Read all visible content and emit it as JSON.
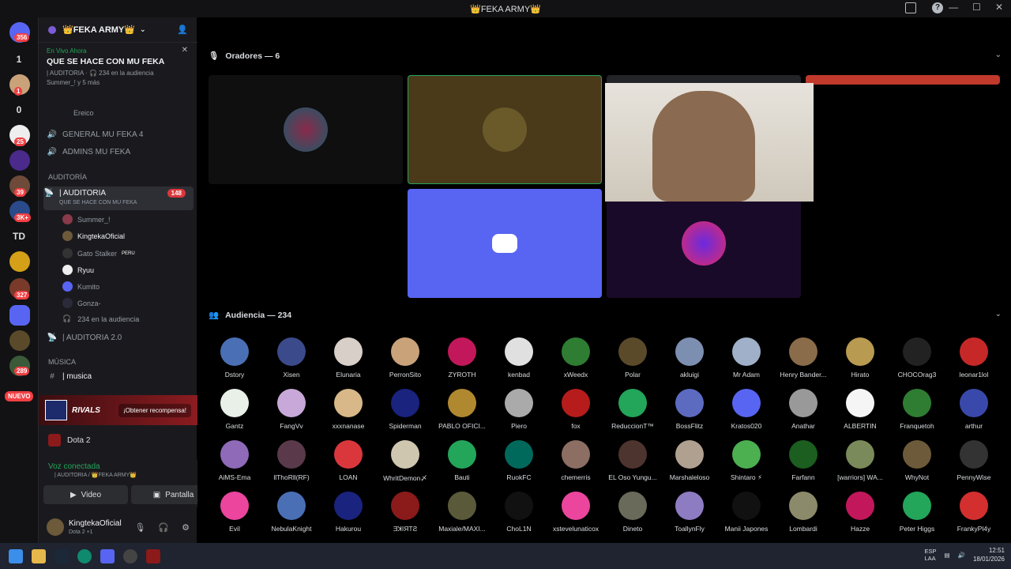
{
  "window": {
    "title": "👑FEKA ARMY👑"
  },
  "servers": {
    "badges": [
      "356",
      "1",
      "25",
      "39",
      "3K+",
      "327",
      "289"
    ],
    "letters": [
      "1",
      "0",
      "TD"
    ],
    "nuevo": "NUEVO"
  },
  "server": {
    "name": "👑FEKA ARMY👑"
  },
  "live": {
    "label": "En Vivo Ahora",
    "title": "QUE SE HACE CON MU FEKA",
    "meta": "| AUDITORIA · 🎧 234 en la audiencia",
    "speakers": "Summer_! y 5 más"
  },
  "channels": {
    "user_top": "Ereico",
    "vc1": "GENERAL MU FEKA 4",
    "vc2": "ADMINS MU FEKA",
    "cat1": "AUDITORÍA",
    "stage": "| AUDITORIA",
    "stage_badge": "148",
    "stage_topic": "QUE SE HACE CON MU FEKA",
    "users": [
      "Summer_!",
      "KingtekaOficial",
      "Gato Stalker",
      "Ryuu",
      "Kumito",
      "Gonza-"
    ],
    "gato_tag": "PERU",
    "audience": "234 en la audiencia",
    "stage2": "| AUDITORIA 2.0",
    "cat2": "MÚSICA",
    "text1": "| musica"
  },
  "banner": {
    "brand": "RIVALS",
    "claim": "¡Obtener recompensa!"
  },
  "game": {
    "name": "Dota 2"
  },
  "voice": {
    "status": "Voz conectada",
    "location": "| AUDITORIA / 👑FEKA ARMY👑",
    "video": "Video",
    "screen": "Pantalla"
  },
  "me": {
    "name": "KingtekaOficial",
    "status": "Dota 2 +1"
  },
  "stage_view": {
    "speakers_header": "Oradores — 6",
    "audience_header": "Audiencia — 234"
  },
  "audience": [
    "Dstory",
    "Xisen",
    "Elunaria",
    "PerronSito",
    "ZYROTH",
    "kenbad",
    "xWeedx",
    "Polar",
    "akluigi",
    "Mr Adam",
    "Henry Bander...",
    "Hirato",
    "CHOCOrag3",
    "leonar1lol",
    "Gantz",
    "FangVv",
    "xxxnanase",
    "Spiderman",
    "PABLO OFICI...",
    "Piero",
    "fox",
    "ReduccionT™",
    "BossFlitz",
    "Kratos020",
    "Anathar",
    "ALBERTIN",
    "Franquetoh",
    "arthur",
    "AiMS-Ema",
    "llThoRll(RF)",
    "LOAN",
    "WhritDemon〆",
    "Bauti",
    "RuokFC",
    "chemerris",
    "EL Oso Yungu...",
    "Marshaleloso",
    "Shintaro ⚡",
    "Farfann",
    "[warriors] WA...",
    "WhyNot",
    "PennyWise",
    "Evil",
    "NebulaKnight",
    "Hakurou",
    "ƎꓘIЯTƧ",
    "Maxiale/MAXI...",
    "ChoL1N",
    "xstevelunaticox",
    "Dineto",
    "ToallynFly",
    "Manii Japones",
    "Lombardi",
    "Hazze",
    "Peter Higgs",
    "FrankyPl4y"
  ],
  "audience_colors": [
    "#4a6fb5",
    "#3b4a8a",
    "#d8d0c8",
    "#c9a27a",
    "#c2185b",
    "#e0e0e0",
    "#2e7d32",
    "#5a4a2a",
    "#7c8fb0",
    "#9fb0c8",
    "#8a6b4a",
    "#b89a50",
    "#222",
    "#c62828",
    "#e8f0e8",
    "#c8a8d8",
    "#d8b888",
    "#1a237e",
    "#b08830",
    "#aaa",
    "#b71c1c",
    "#23a55a",
    "#5c6bc0",
    "#5865f2",
    "#999",
    "#f5f5f5",
    "#2e7d32",
    "#3949ab",
    "#8e6ab8",
    "#5a3a4a",
    "#da373c",
    "#cfc6b0",
    "#23a55a",
    "#00695c",
    "#8d6e63",
    "#4e342e",
    "#b0a090",
    "#4caf50",
    "#1b5e20",
    "#7a8a5a",
    "#6d5a3a",
    "#333",
    "#eb459e",
    "#4a6fb5",
    "#1a237e",
    "#8b1a1a",
    "#5a5a3a",
    "#111",
    "#eb459e",
    "#6a6a5a",
    "#8e7cc3",
    "#111",
    "#8b8b6b",
    "#c2185b",
    "#23a55a",
    "#d32f2f"
  ],
  "tray": {
    "lang1": "ESP",
    "lang2": "LAA",
    "time": "12:51",
    "date": "18/01/2026"
  }
}
